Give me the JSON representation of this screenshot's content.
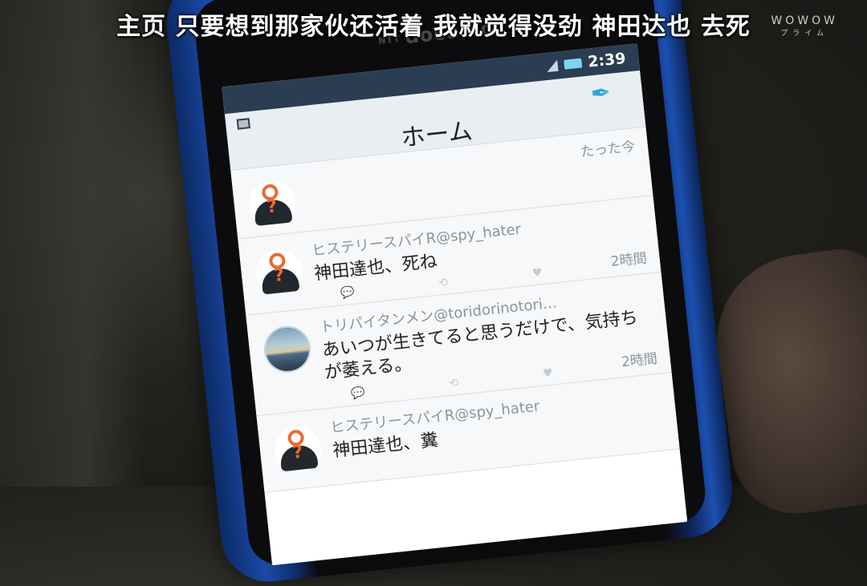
{
  "subtitle": "主页 只要想到那家伙还活着 我就觉得没劲 神田达也 去死",
  "watermark": {
    "main": "WOWOW",
    "sub": "プライム"
  },
  "phone": {
    "carrier_small": "NTT",
    "carrier": "docomo"
  },
  "status_bar": {
    "time": "2:39"
  },
  "app_bar": {
    "title": "ホーム"
  },
  "tweets": [
    {
      "name": "",
      "text": "",
      "time": "たった今"
    },
    {
      "name": "ヒステリースパイR@spy_hater",
      "text": "神田達也、死ね",
      "time": "2時間"
    },
    {
      "name": "トリパイタンメン@toridorinotori…",
      "text": "あいつが生きてると思うだけで、気持ちが萎える。",
      "time": "2時間"
    },
    {
      "name": "ヒステリースパイR@spy_hater",
      "text": "神田達也、糞",
      "time": ""
    }
  ],
  "colors": {
    "accent": "#2aa6d6",
    "status_bar": "#2b3d52",
    "spy_orange": "#ea6a32"
  }
}
